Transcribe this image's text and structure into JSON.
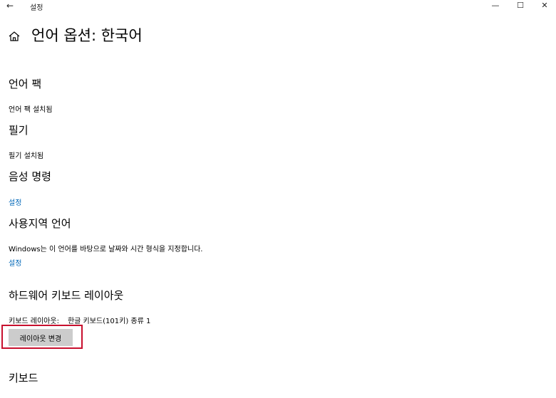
{
  "window": {
    "app_title": "설정",
    "back_icon": "←",
    "minimize_icon": "—",
    "maximize_icon": "☐",
    "close_icon": "✕"
  },
  "page": {
    "title": "언어 옵션: 한국어",
    "home_icon": "home-icon"
  },
  "sections": {
    "language_pack": {
      "heading": "언어 팩",
      "status": "언어 팩 설치됨"
    },
    "handwriting": {
      "heading": "필기",
      "status": "필기 설치됨"
    },
    "speech": {
      "heading": "음성 명령",
      "link": "설정"
    },
    "regional": {
      "heading": "사용지역 언어",
      "description": "Windows는 이 언어를 바탕으로 날짜와 시간 형식을 지정합니다.",
      "link": "설정"
    },
    "hardware_keyboard": {
      "heading": "하드웨어 키보드 레이아웃",
      "layout_label": "키보드 레이아웃:",
      "layout_value": "한글 키보드(101키) 종류 1",
      "change_button": "레이아웃 변경"
    },
    "keyboard": {
      "heading": "키보드"
    }
  },
  "colors": {
    "link": "#0067b8",
    "button_bg": "#cccccc",
    "highlight": "#c8102e"
  }
}
